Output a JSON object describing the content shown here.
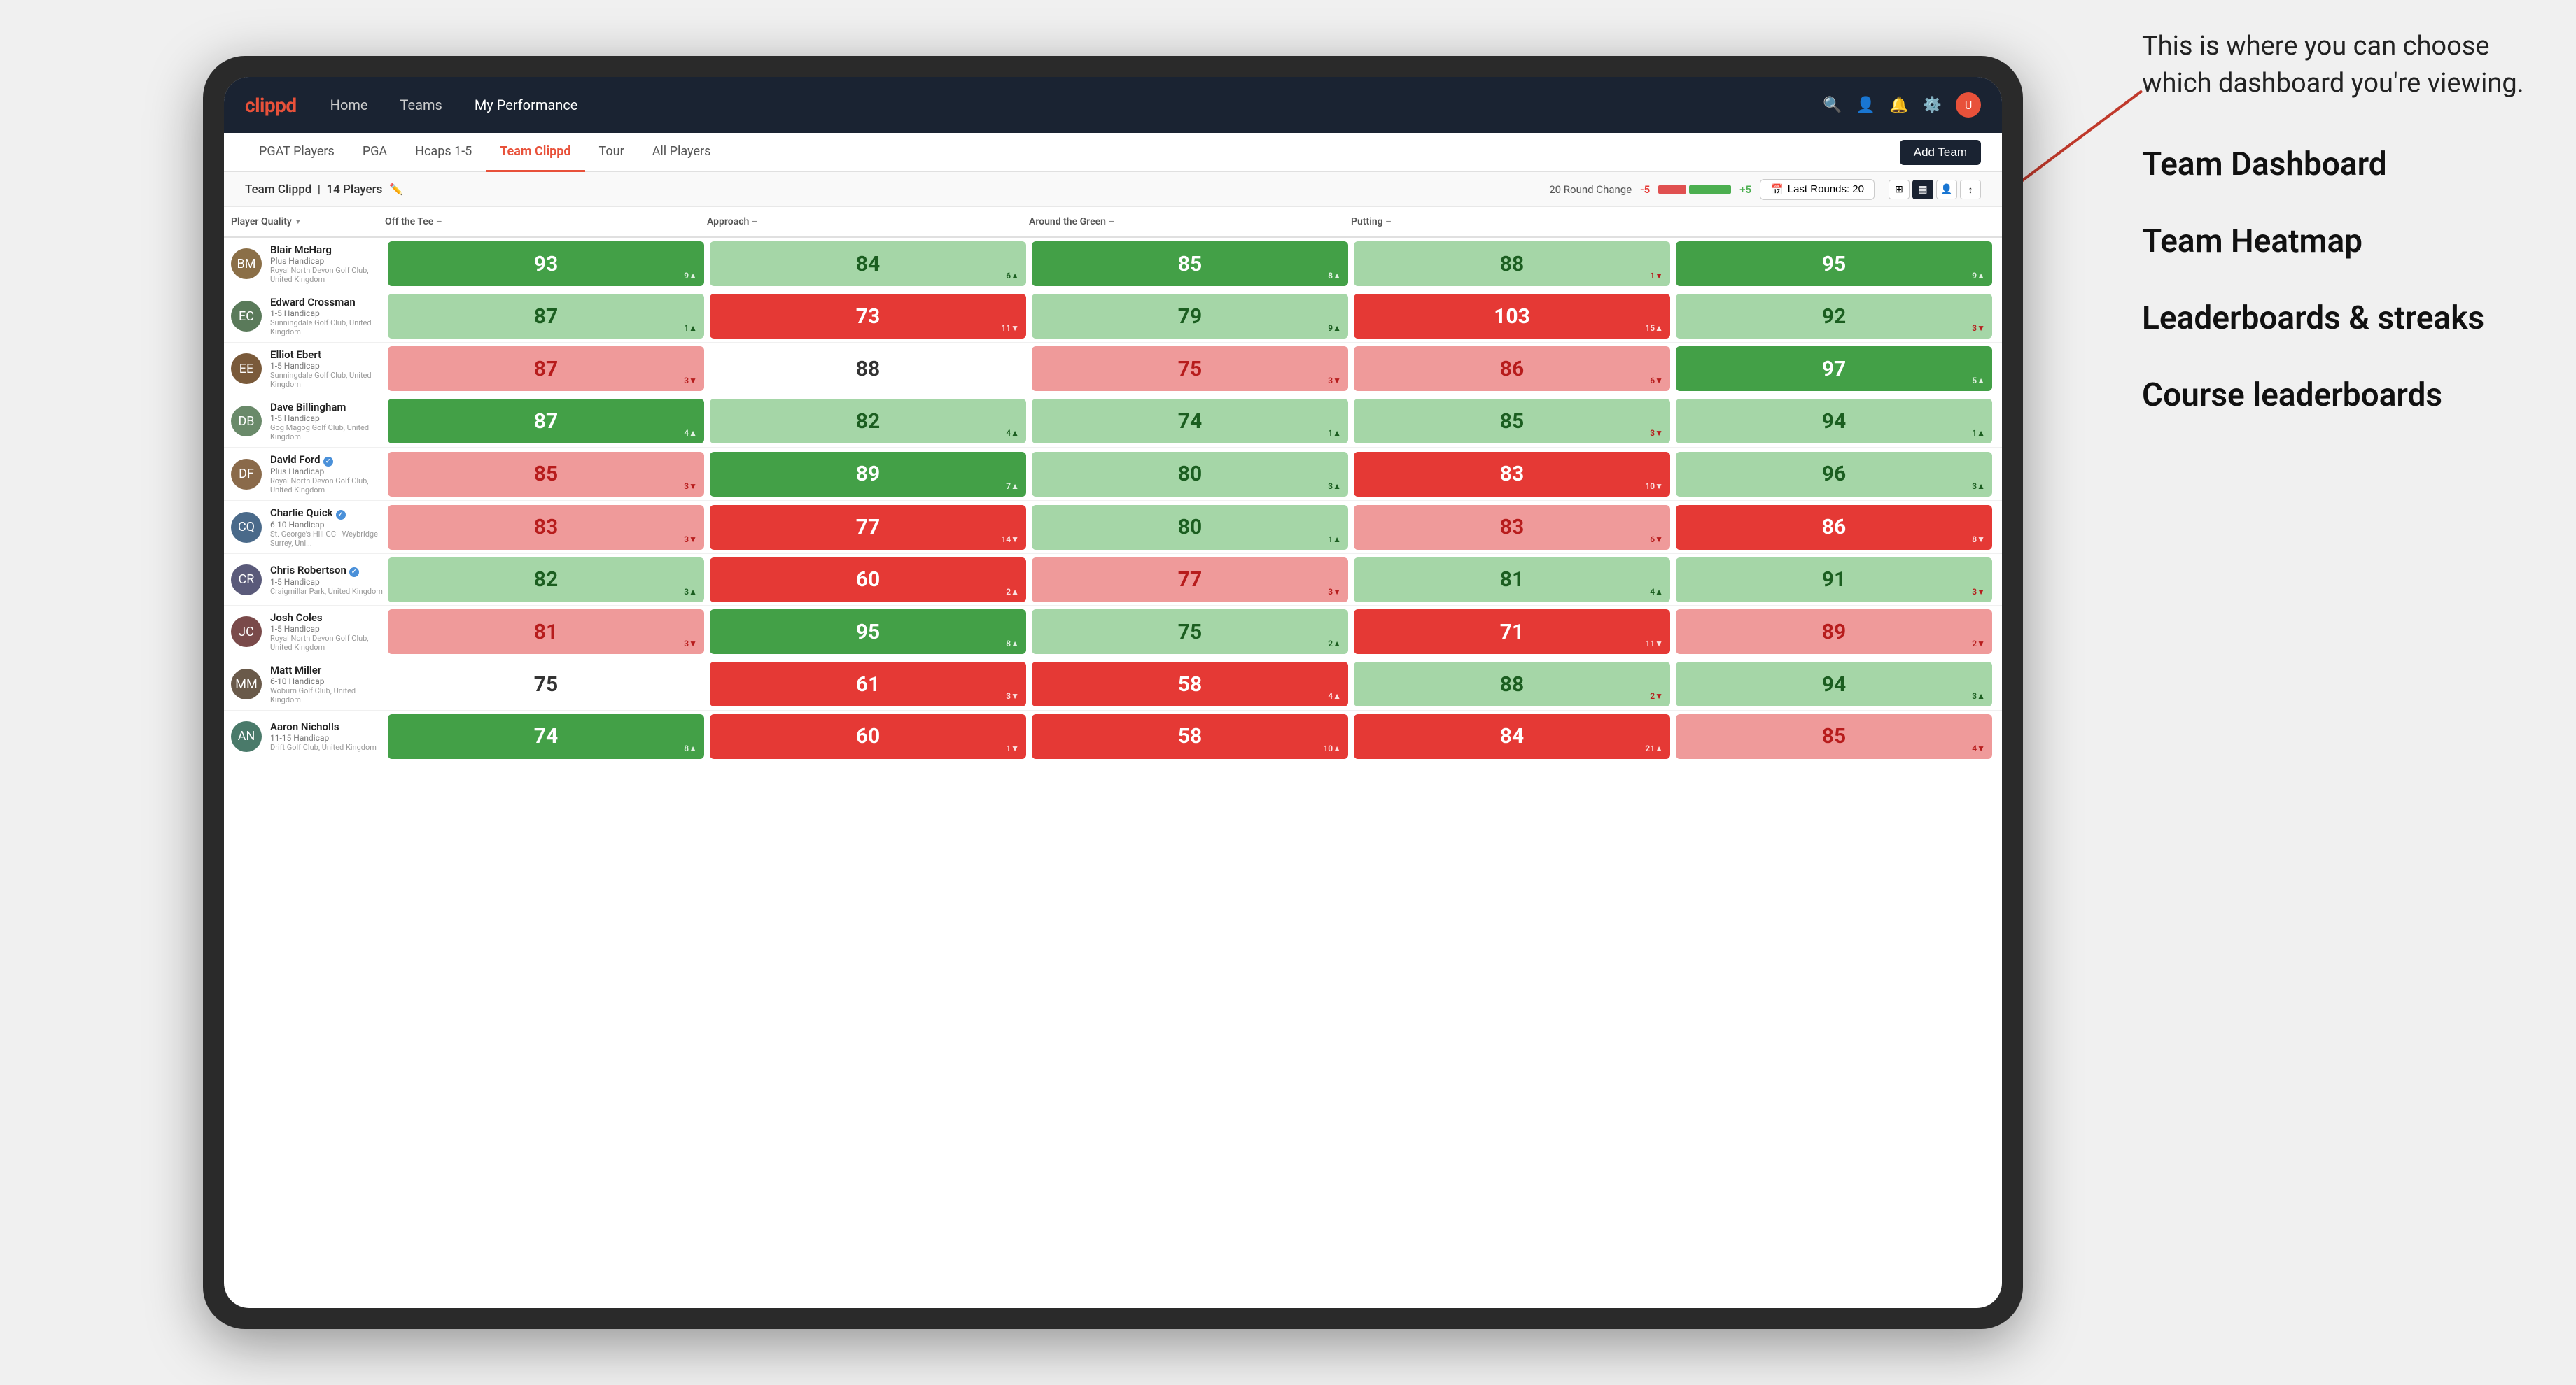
{
  "annotation": {
    "intro_text": "This is where you can choose which dashboard you're viewing.",
    "items": [
      {
        "label": "Team Dashboard"
      },
      {
        "label": "Team Heatmap"
      },
      {
        "label": "Leaderboards & streaks"
      },
      {
        "label": "Course leaderboards"
      }
    ]
  },
  "nav": {
    "logo": "clippd",
    "links": [
      {
        "label": "Home",
        "active": false
      },
      {
        "label": "Teams",
        "active": false
      },
      {
        "label": "My Performance",
        "active": true
      }
    ],
    "add_team_label": "Add Team"
  },
  "sub_nav": {
    "links": [
      {
        "label": "PGAT Players",
        "active": false
      },
      {
        "label": "PGA",
        "active": false
      },
      {
        "label": "Hcaps 1-5",
        "active": false
      },
      {
        "label": "Team Clippd",
        "active": true
      },
      {
        "label": "Tour",
        "active": false
      },
      {
        "label": "All Players",
        "active": false
      }
    ]
  },
  "team_header": {
    "name": "Team Clippd",
    "count": "14 Players",
    "round_change_label": "20 Round Change",
    "neg_label": "-5",
    "pos_label": "+5",
    "last_rounds_label": "Last Rounds: 20"
  },
  "table": {
    "columns": [
      {
        "label": "Player Quality",
        "sortable": true
      },
      {
        "label": "Off the Tee",
        "sortable": true
      },
      {
        "label": "Approach",
        "sortable": true
      },
      {
        "label": "Around the Green",
        "sortable": true
      },
      {
        "label": "Putting",
        "sortable": true
      }
    ],
    "rows": [
      {
        "name": "Blair McHarg",
        "handicap": "Plus Handicap",
        "club": "Royal North Devon Golf Club, United Kingdom",
        "verified": false,
        "avatar_color": "#8B6F47",
        "initials": "BM",
        "scores": [
          {
            "value": "93",
            "change": "9▲",
            "bg": "green-dark",
            "dir": "up"
          },
          {
            "value": "84",
            "change": "6▲",
            "bg": "green-light",
            "dir": "up"
          },
          {
            "value": "85",
            "change": "8▲",
            "bg": "green-dark",
            "dir": "up"
          },
          {
            "value": "88",
            "change": "1▼",
            "bg": "green-light",
            "dir": "down"
          },
          {
            "value": "95",
            "change": "9▲",
            "bg": "green-dark",
            "dir": "up"
          }
        ]
      },
      {
        "name": "Edward Crossman",
        "handicap": "1-5 Handicap",
        "club": "Sunningdale Golf Club, United Kingdom",
        "verified": false,
        "avatar_color": "#5a7a5a",
        "initials": "EC",
        "scores": [
          {
            "value": "87",
            "change": "1▲",
            "bg": "green-light",
            "dir": "up"
          },
          {
            "value": "73",
            "change": "11▼",
            "bg": "red-dark",
            "dir": "down"
          },
          {
            "value": "79",
            "change": "9▲",
            "bg": "green-light",
            "dir": "up"
          },
          {
            "value": "103",
            "change": "15▲",
            "bg": "red-dark",
            "dir": "up"
          },
          {
            "value": "92",
            "change": "3▼",
            "bg": "green-light",
            "dir": "down"
          }
        ]
      },
      {
        "name": "Elliot Ebert",
        "handicap": "1-5 Handicap",
        "club": "Sunningdale Golf Club, United Kingdom",
        "verified": false,
        "avatar_color": "#7a5a3a",
        "initials": "EE",
        "scores": [
          {
            "value": "87",
            "change": "3▼",
            "bg": "red-light",
            "dir": "down"
          },
          {
            "value": "88",
            "change": "",
            "bg": "white",
            "dir": ""
          },
          {
            "value": "75",
            "change": "3▼",
            "bg": "red-light",
            "dir": "down"
          },
          {
            "value": "86",
            "change": "6▼",
            "bg": "red-light",
            "dir": "down"
          },
          {
            "value": "97",
            "change": "5▲",
            "bg": "green-dark",
            "dir": "up"
          }
        ]
      },
      {
        "name": "Dave Billingham",
        "handicap": "1-5 Handicap",
        "club": "Gog Magog Golf Club, United Kingdom",
        "verified": false,
        "avatar_color": "#6a8a6a",
        "initials": "DB",
        "scores": [
          {
            "value": "87",
            "change": "4▲",
            "bg": "green-dark",
            "dir": "up"
          },
          {
            "value": "82",
            "change": "4▲",
            "bg": "green-light",
            "dir": "up"
          },
          {
            "value": "74",
            "change": "1▲",
            "bg": "green-light",
            "dir": "up"
          },
          {
            "value": "85",
            "change": "3▼",
            "bg": "green-light",
            "dir": "down"
          },
          {
            "value": "94",
            "change": "1▲",
            "bg": "green-light",
            "dir": "up"
          }
        ]
      },
      {
        "name": "David Ford",
        "handicap": "Plus Handicap",
        "club": "Royal North Devon Golf Club, United Kingdom",
        "verified": true,
        "avatar_color": "#8a6a4a",
        "initials": "DF",
        "scores": [
          {
            "value": "85",
            "change": "3▼",
            "bg": "red-light",
            "dir": "down"
          },
          {
            "value": "89",
            "change": "7▲",
            "bg": "green-dark",
            "dir": "up"
          },
          {
            "value": "80",
            "change": "3▲",
            "bg": "green-light",
            "dir": "up"
          },
          {
            "value": "83",
            "change": "10▼",
            "bg": "red-dark",
            "dir": "down"
          },
          {
            "value": "96",
            "change": "3▲",
            "bg": "green-light",
            "dir": "up"
          }
        ]
      },
      {
        "name": "Charlie Quick",
        "handicap": "6-10 Handicap",
        "club": "St. George's Hill GC - Weybridge - Surrey, Uni...",
        "verified": true,
        "avatar_color": "#4a6a8a",
        "initials": "CQ",
        "scores": [
          {
            "value": "83",
            "change": "3▼",
            "bg": "red-light",
            "dir": "down"
          },
          {
            "value": "77",
            "change": "14▼",
            "bg": "red-dark",
            "dir": "down"
          },
          {
            "value": "80",
            "change": "1▲",
            "bg": "green-light",
            "dir": "up"
          },
          {
            "value": "83",
            "change": "6▼",
            "bg": "red-light",
            "dir": "down"
          },
          {
            "value": "86",
            "change": "8▼",
            "bg": "red-dark",
            "dir": "down"
          }
        ]
      },
      {
        "name": "Chris Robertson",
        "handicap": "1-5 Handicap",
        "club": "Craigmillar Park, United Kingdom",
        "verified": true,
        "avatar_color": "#5a5a7a",
        "initials": "CR",
        "scores": [
          {
            "value": "82",
            "change": "3▲",
            "bg": "green-light",
            "dir": "up"
          },
          {
            "value": "60",
            "change": "2▲",
            "bg": "red-dark",
            "dir": "up"
          },
          {
            "value": "77",
            "change": "3▼",
            "bg": "red-light",
            "dir": "down"
          },
          {
            "value": "81",
            "change": "4▲",
            "bg": "green-light",
            "dir": "up"
          },
          {
            "value": "91",
            "change": "3▼",
            "bg": "green-light",
            "dir": "down"
          }
        ]
      },
      {
        "name": "Josh Coles",
        "handicap": "1-5 Handicap",
        "club": "Royal North Devon Golf Club, United Kingdom",
        "verified": false,
        "avatar_color": "#7a4a4a",
        "initials": "JC",
        "scores": [
          {
            "value": "81",
            "change": "3▼",
            "bg": "red-light",
            "dir": "down"
          },
          {
            "value": "95",
            "change": "8▲",
            "bg": "green-dark",
            "dir": "up"
          },
          {
            "value": "75",
            "change": "2▲",
            "bg": "green-light",
            "dir": "up"
          },
          {
            "value": "71",
            "change": "11▼",
            "bg": "red-dark",
            "dir": "down"
          },
          {
            "value": "89",
            "change": "2▼",
            "bg": "red-light",
            "dir": "down"
          }
        ]
      },
      {
        "name": "Matt Miller",
        "handicap": "6-10 Handicap",
        "club": "Woburn Golf Club, United Kingdom",
        "verified": false,
        "avatar_color": "#6a5a4a",
        "initials": "MM",
        "scores": [
          {
            "value": "75",
            "change": "",
            "bg": "white",
            "dir": ""
          },
          {
            "value": "61",
            "change": "3▼",
            "bg": "red-dark",
            "dir": "down"
          },
          {
            "value": "58",
            "change": "4▲",
            "bg": "red-dark",
            "dir": "up"
          },
          {
            "value": "88",
            "change": "2▼",
            "bg": "green-light",
            "dir": "down"
          },
          {
            "value": "94",
            "change": "3▲",
            "bg": "green-light",
            "dir": "up"
          }
        ]
      },
      {
        "name": "Aaron Nicholls",
        "handicap": "11-15 Handicap",
        "club": "Drift Golf Club, United Kingdom",
        "verified": false,
        "avatar_color": "#4a7a6a",
        "initials": "AN",
        "scores": [
          {
            "value": "74",
            "change": "8▲",
            "bg": "green-dark",
            "dir": "up"
          },
          {
            "value": "60",
            "change": "1▼",
            "bg": "red-dark",
            "dir": "down"
          },
          {
            "value": "58",
            "change": "10▲",
            "bg": "red-dark",
            "dir": "up"
          },
          {
            "value": "84",
            "change": "21▲",
            "bg": "red-dark",
            "dir": "up"
          },
          {
            "value": "85",
            "change": "4▼",
            "bg": "red-light",
            "dir": "down"
          }
        ]
      }
    ]
  }
}
